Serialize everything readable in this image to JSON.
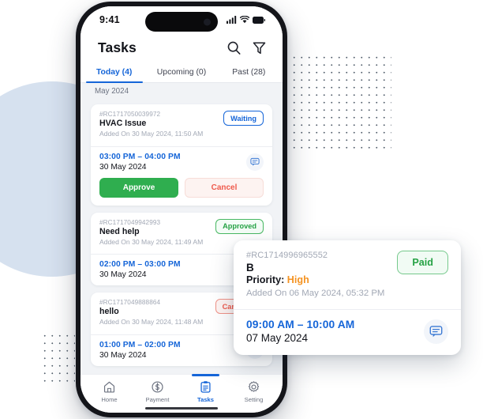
{
  "statusbar": {
    "time": "9:41",
    "icons": [
      "signal-icon",
      "wifi-icon",
      "battery-icon"
    ]
  },
  "header": {
    "title": "Tasks",
    "search_icon": "search-icon",
    "filter_icon": "filter-icon"
  },
  "tabs": [
    {
      "label": "Today (4)",
      "active": true
    },
    {
      "label": "Upcoming (0)",
      "active": false
    },
    {
      "label": "Past (28)",
      "active": false
    }
  ],
  "month_header": "May 2024",
  "cards": [
    {
      "ref": "#RC1717050039972",
      "title": "HVAC Issue",
      "added": "Added On 30 May 2024, 11:50 AM",
      "status": "Waiting",
      "status_type": "waiting",
      "time_range": "03:00 PM – 04:00 PM",
      "date": "30 May 2024",
      "chat_icon": "chat-bubble-icon",
      "actions": {
        "approve": "Approve",
        "cancel": "Cancel"
      }
    },
    {
      "ref": "#RC1717049942993",
      "title": "Need help",
      "added": "Added On 30 May 2024, 11:49 AM",
      "status": "Approved",
      "status_type": "approved",
      "time_range": "02:00 PM – 03:00 PM",
      "date": "30 May 2024",
      "chat_icon": "chat-bubble-icon"
    },
    {
      "ref": "#RC1717049888864",
      "title": "hello",
      "added": "Added On 30 May 2024, 11:48 AM",
      "status": "Cancelled",
      "status_type": "cancelled",
      "time_range": "01:00 PM – 02:00 PM",
      "date": "30 May 2024",
      "chat_icon": "chat-bubble-icon"
    }
  ],
  "float_card": {
    "ref": "#RC1714996965552",
    "title": "B",
    "priority_label": "Priority:",
    "priority_value": "High",
    "added": "Added On 06 May 2024, 05:32 PM",
    "status": "Paid",
    "time_range": "09:00 AM – 10:00 AM",
    "date": "07 May 2024",
    "chat_icon": "chat-bubble-icon"
  },
  "bottom_nav": [
    {
      "label": "Home",
      "icon": "home-icon",
      "active": false
    },
    {
      "label": "Payment",
      "icon": "dollar-circle-icon",
      "active": false
    },
    {
      "label": "Tasks",
      "icon": "clipboard-icon",
      "active": true
    },
    {
      "label": "Setting",
      "icon": "gear-icon",
      "active": false
    }
  ],
  "colors": {
    "accent_blue": "#1565d8",
    "success_green": "#2fae4f",
    "danger_red": "#ef5a4c",
    "priority_orange": "#f59322",
    "list_bg": "#f1f3f6",
    "circle_decor": "#d6e1ef"
  }
}
